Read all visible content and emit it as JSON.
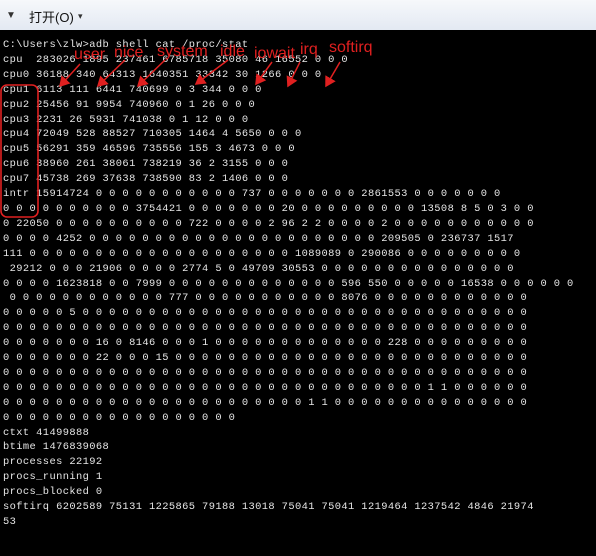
{
  "toolbar": {
    "dropdown_icon": "chevron-down-icon",
    "open_label": "打开(O)",
    "chevron": "▾"
  },
  "console": {
    "lines": [
      "C:\\Users\\zlw>adb shell cat /proc/stat",
      "cpu  283026 1895 237461 6785718 35080 46 16552 0 0 0",
      "cpu0 36188 340 64313 1640351 33342 30 1266 0 0 0",
      "cpu1 6113 111 6441 740699 0 3 344 0 0 0",
      "cpu2 25456 91 9954 740960 0 1 26 0 0 0",
      "cpu3 2231 26 5931 741038 0 1 12 0 0 0",
      "cpu4 72049 528 88527 710305 1464 4 5650 0 0 0",
      "cpu5 56291 359 46596 735556 155 3 4673 0 0 0",
      "cpu6 38960 261 38061 738219 36 2 3155 0 0 0",
      "cpu7 45738 269 37638 738590 83 2 1406 0 0 0",
      "intr 15914724 0 0 0 0 0 0 0 0 0 0 0 737 0 0 0 0 0 0 0 2861553 0 0 0 0 0 0 0",
      "0 0 0 0 0 0 0 0 0 0 3754421 0 0 0 0 0 0 0 20 0 0 0 0 0 0 0 0 0 13508 8 5 0 3 0 0",
      "0 22050 0 0 0 0 0 0 0 0 0 0 722 0 0 0 0 2 96 2 2 0 0 0 0 2 0 0 0 0 0 0 0 0 0 0 0",
      "0 0 0 0 4252 0 0 0 0 0 0 0 0 0 0 0 0 0 0 0 0 0 0 0 0 0 0 209505 0 236737 1517",
      "111 0 0 0 0 0 0 0 0 0 0 0 0 0 0 0 0 0 0 0 0 1089089 0 290086 0 0 0 0 0 0 0 0 0",
      " 29212 0 0 0 21906 0 0 0 0 2774 5 0 49709 30553 0 0 0 0 0 0 0 0 0 0 0 0 0 0 0",
      "0 0 0 0 1623818 0 0 7999 0 0 0 0 0 0 0 0 0 0 0 0 0 596 550 0 0 0 0 0 16538 0 0 0 0 0 0",
      " 0 0 0 0 0 0 0 0 0 0 0 0 777 0 0 0 0 0 0 0 0 0 0 0 8076 0 0 0 0 0 0 0 0 0 0 0 0",
      "0 0 0 0 0 5 0 0 0 0 0 0 0 0 0 0 0 0 0 0 0 0 0 0 0 0 0 0 0 0 0 0 0 0 0 0 0 0 0 0",
      "0 0 0 0 0 0 0 0 0 0 0 0 0 0 0 0 0 0 0 0 0 0 0 0 0 0 0 0 0 0 0 0 0 0 0 0 0 0 0 0",
      "0 0 0 0 0 0 0 16 0 8146 0 0 0 1 0 0 0 0 0 0 0 0 0 0 0 0 0 228 0 0 0 0 0 0 0 0 0",
      "0 0 0 0 0 0 0 22 0 0 0 15 0 0 0 0 0 0 0 0 0 0 0 0 0 0 0 0 0 0 0 0 0 0 0 0 0 0 0",
      "0 0 0 0 0 0 0 0 0 0 0 0 0 0 0 0 0 0 0 0 0 0 0 0 0 0 0 0 0 0 0 0 0 0 0 0 0 0 0 0",
      "0 0 0 0 0 0 0 0 0 0 0 0 0 0 0 0 0 0 0 0 0 0 0 0 0 0 0 0 0 0 0 0 1 1 0 0 0 0 0 0",
      "0 0 0 0 0 0 0 0 0 0 0 0 0 0 0 0 0 0 0 0 0 0 0 1 1 0 0 0 0 0 0 0 0 0 0 0 0 0 0 0",
      "0 0 0 0 0 0 0 0 0 0 0 0 0 0 0 0 0 0",
      "ctxt 41499888",
      "btime 1476839068",
      "processes 22192",
      "procs_running 1",
      "procs_blocked 0",
      "softirq 6202589 75131 1225865 79188 13018 75041 75041 1219464 1237542 4846 21974",
      "53"
    ]
  },
  "annotations": {
    "user": "user",
    "nice": "nice",
    "system": "system",
    "idle": "idle",
    "iowait": "iowait",
    "irq": "irq",
    "softirq": "softirq",
    "color": "#e02020"
  }
}
